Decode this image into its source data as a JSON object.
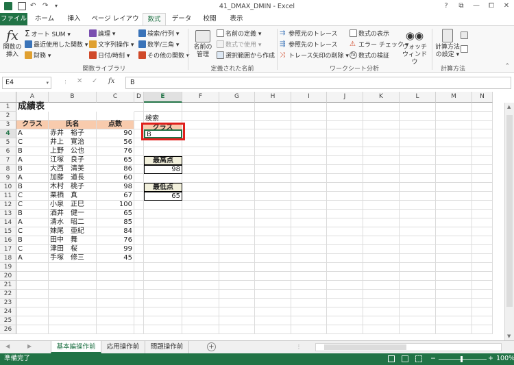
{
  "window": {
    "title": "41_DMAX_DMIN - Excel",
    "controls": [
      "?",
      "⧉",
      "—",
      "⧠",
      "✕"
    ]
  },
  "ribbon_tabs": [
    "ファイル",
    "ホーム",
    "挿入",
    "ページ レイアウト",
    "数式",
    "データ",
    "校閲",
    "表示"
  ],
  "active_tab": "数式",
  "ribbon": {
    "insert_function": "関数の\n挿入",
    "autosum": "オート SUM ▾",
    "recent": "最近使用した関数 ▾",
    "financial": "財務 ▾",
    "logical": "論理 ▾",
    "text": "文字列操作 ▾",
    "datetime": "日付/時刻 ▾",
    "lookup": "検索/行列 ▾",
    "math": "数学/三角 ▾",
    "more": "その他の関数 ▾",
    "group_library": "関数ライブラリ",
    "name_manager": "名前の\n管理",
    "define_name": "名前の定義 ▾",
    "use_in_formula": "数式で使用 ▾",
    "create_from_selection": "選択範囲から作成",
    "group_names": "定義された名前",
    "trace_precedents": "参照元のトレース",
    "trace_dependents": "参照先のトレース",
    "remove_arrows": "トレース矢印の削除 ▾",
    "show_formulas": "数式の表示",
    "error_checking": "エラー チェック ▾",
    "evaluate_formula": "数式の検証",
    "watch_window": "ウォッチ\nウィンドウ",
    "group_audit": "ワークシート分析",
    "calc_options": "計算方法\nの設定 ▾",
    "group_calc": "計算方法"
  },
  "formula_bar": {
    "name_box": "E4",
    "content": "B"
  },
  "columns": [
    "A",
    "B",
    "C",
    "D",
    "E",
    "F",
    "G",
    "H",
    "I",
    "J",
    "K",
    "L",
    "M",
    "N"
  ],
  "rows": [
    "1",
    "2",
    "3",
    "4",
    "5",
    "6",
    "7",
    "8",
    "9",
    "10",
    "11",
    "12",
    "13",
    "14",
    "15",
    "16",
    "17",
    "18",
    "19",
    "20",
    "21",
    "22",
    "23",
    "24",
    "25",
    "26"
  ],
  "sheet": {
    "title": "成績表",
    "headers": [
      "クラス",
      "氏名",
      "点数"
    ],
    "records": [
      [
        "A",
        "赤井　裕子",
        "90"
      ],
      [
        "C",
        "井上　寛治",
        "56"
      ],
      [
        "B",
        "上野　公也",
        "76"
      ],
      [
        "A",
        "江塚　良子",
        "65"
      ],
      [
        "B",
        "大西　清美",
        "86"
      ],
      [
        "A",
        "加藤　道長",
        "60"
      ],
      [
        "B",
        "木村　桃子",
        "98"
      ],
      [
        "C",
        "栗栖　真",
        "67"
      ],
      [
        "C",
        "小泉　正巳",
        "100"
      ],
      [
        "B",
        "酒井　健一",
        "65"
      ],
      [
        "A",
        "清水　昭二",
        "85"
      ],
      [
        "C",
        "妹尾　亜紀",
        "84"
      ],
      [
        "B",
        "田中　舞",
        "76"
      ],
      [
        "C",
        "津田　桜",
        "99"
      ],
      [
        "A",
        "手塚　修三",
        "45"
      ]
    ],
    "search_title": "検索",
    "search_header": "クラス",
    "search_value": "B",
    "max_label": "最高点",
    "max_value": "98",
    "min_label": "最低点",
    "min_value": "65"
  },
  "sheet_tabs": [
    "基本編操作前",
    "応用操作前",
    "問題操作前"
  ],
  "active_sheet": "基本編操作前",
  "status": {
    "ready": "準備完了",
    "zoom": "100%"
  },
  "colors": {
    "accent": "#217346",
    "header_fill": "#f8cbad",
    "label_fill": "#f2f0dc",
    "highlight": "#e0201c"
  }
}
